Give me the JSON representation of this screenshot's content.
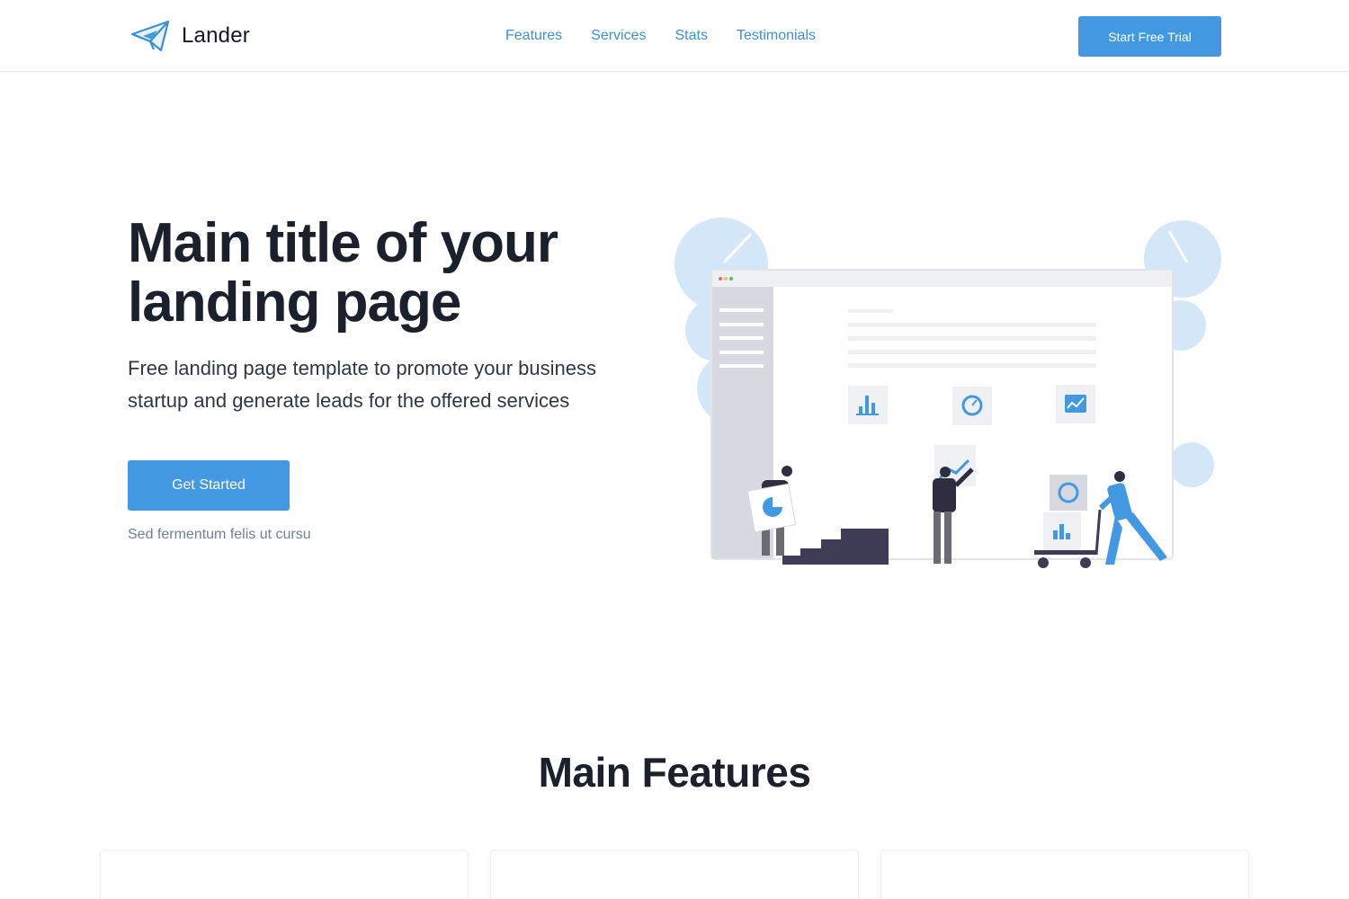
{
  "header": {
    "brand": "Lander",
    "nav": [
      {
        "label": "Features"
      },
      {
        "label": "Services"
      },
      {
        "label": "Stats"
      },
      {
        "label": "Testimonials"
      }
    ],
    "cta_label": "Start Free Trial"
  },
  "hero": {
    "title": "Main title of your landing page",
    "subtitle": "Free landing page template to promote your business startup and generate leads for the offered services",
    "button_label": "Get Started",
    "note": "Sed fermentum felis ut cursu"
  },
  "features": {
    "title": "Main Features",
    "cards": [
      {},
      {},
      {}
    ]
  },
  "colors": {
    "accent": "#4299e1",
    "nav_link": "#3b90d6",
    "heading": "#1a202c",
    "muted": "#718096"
  },
  "icons": {
    "logo": "paper-plane-icon"
  }
}
